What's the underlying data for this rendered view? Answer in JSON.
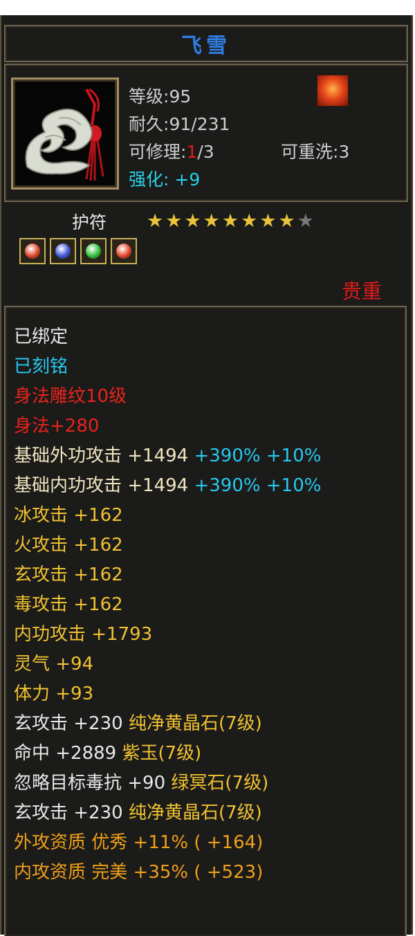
{
  "item": {
    "name": "飞雪",
    "level_label": "等级",
    "level": "95",
    "durability_label": "耐久",
    "durability": "91/231",
    "repair_label": "可修理",
    "repair_used": "1",
    "repair_total": "/3",
    "reroll_label": "可重洗",
    "reroll": "3",
    "enhance_label": "强化",
    "enhance": "+9",
    "type": "护符",
    "stars_filled": 8,
    "stars_total": 9,
    "rarity": "贵重",
    "gems": [
      "red-gem",
      "blue-gem",
      "green-gem",
      "red-gem"
    ],
    "icon": "jade-pendant-icon",
    "element_icon": "fire-emblem-icon"
  },
  "attributes": [
    {
      "text": "已绑定",
      "color": "white"
    },
    {
      "text": "已刻铭",
      "color": "cyan"
    },
    {
      "text": "身法雕纹10级",
      "color": "red"
    },
    {
      "text": "身法+280",
      "color": "red"
    },
    {
      "text": "基础外功攻击 +1494",
      "extra": "+390% +10%",
      "color": "light",
      "extra_color": "cyan"
    },
    {
      "text": "基础内功攻击 +1494",
      "extra": "+390% +10%",
      "color": "light",
      "extra_color": "cyan"
    },
    {
      "text": "冰攻击 +162",
      "color": "yellow"
    },
    {
      "text": "火攻击 +162",
      "color": "yellow"
    },
    {
      "text": "玄攻击 +162",
      "color": "yellow"
    },
    {
      "text": "毒攻击 +162",
      "color": "yellow"
    },
    {
      "text": "内功攻击 +1793",
      "color": "yellow"
    },
    {
      "text": "灵气 +94",
      "color": "yellow"
    },
    {
      "text": "体力 +93",
      "color": "yellow"
    },
    {
      "text": "玄攻击 +230",
      "extra": "纯净黄晶石(7级)",
      "color": "white",
      "extra_color": "yellow"
    },
    {
      "text": "命中 +2889",
      "extra": "紫玉(7级)",
      "color": "white",
      "extra_color": "yellow"
    },
    {
      "text": "忽略目标毒抗 +90",
      "extra": "绿冥石(7级)",
      "color": "white",
      "extra_color": "yellow"
    },
    {
      "text": "玄攻击 +230",
      "extra": "纯净黄晶石(7级)",
      "color": "white",
      "extra_color": "yellow"
    },
    {
      "text": "外攻资质  优秀 +11% ( +164)",
      "color": "orange"
    },
    {
      "text": "内攻资质  完美 +35% ( +523)",
      "color": "orange"
    }
  ],
  "colors": {
    "white": "#e8e8e8",
    "cyan": "#27c9f0",
    "red": "#e8231b",
    "yellow": "#f1c232",
    "orange": "#f0a01a",
    "light": "#f0e6c0",
    "title": "#2f7de0"
  }
}
